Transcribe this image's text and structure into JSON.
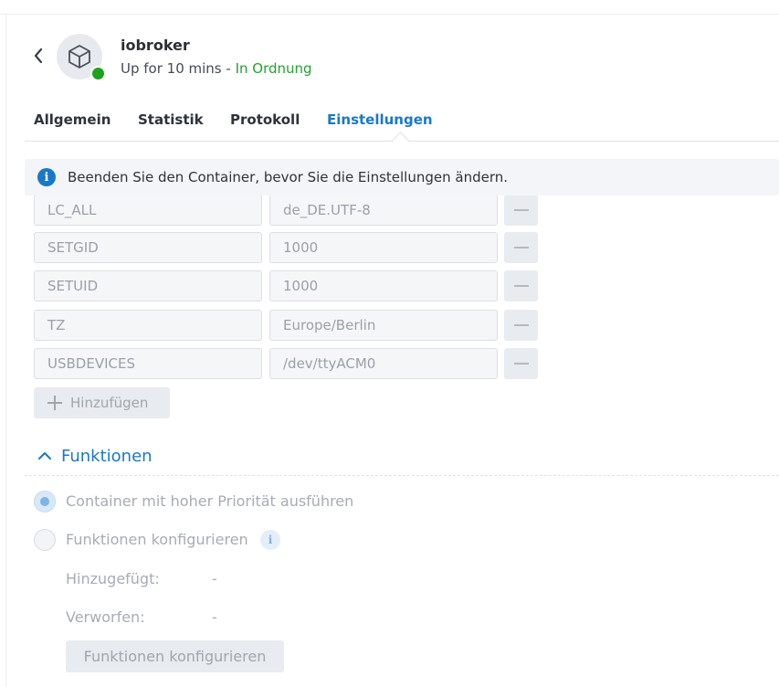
{
  "header": {
    "name": "iobroker",
    "uptime": "Up for 10 mins - ",
    "status": "In Ordnung",
    "status_color": "#1ea52d"
  },
  "tabs": [
    {
      "label": "Allgemein",
      "active": false
    },
    {
      "label": "Statistik",
      "active": false
    },
    {
      "label": "Protokoll",
      "active": false
    },
    {
      "label": "Einstellungen",
      "active": true
    }
  ],
  "info_banner": {
    "icon": "info-icon",
    "text": "Beenden Sie den Container, bevor Sie die Einstellungen ändern."
  },
  "env_vars": [
    {
      "key": "LC_ALL",
      "value": "de_DE.UTF-8"
    },
    {
      "key": "SETGID",
      "value": "1000"
    },
    {
      "key": "SETUID",
      "value": "1000"
    },
    {
      "key": "TZ",
      "value": "Europe/Berlin"
    },
    {
      "key": "USBDEVICES",
      "value": "/dev/ttyACM0"
    }
  ],
  "add_button": "Hinzufügen",
  "functions": {
    "title": "Funktionen",
    "options": [
      {
        "label": "Container mit hoher Priorität ausführen",
        "checked": true
      },
      {
        "label": "Funktionen konfigurieren",
        "checked": false
      }
    ],
    "added_label": "Hinzugefügt:",
    "added_value": "-",
    "discarded_label": "Verworfen:",
    "discarded_value": "-",
    "configure_button": "Funktionen konfigurieren"
  },
  "colors": {
    "accent": "#1a78c8",
    "ok": "#1ea52d"
  }
}
